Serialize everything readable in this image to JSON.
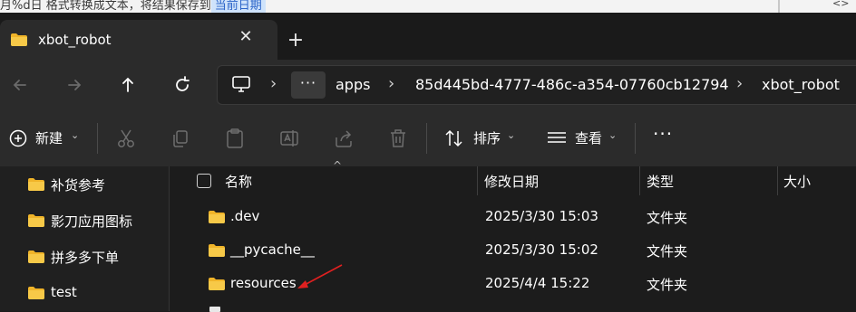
{
  "top_strip": {
    "left_text": "月%d日 格式转换成文本，将结果保存到",
    "highlight_text": "当前日期"
  },
  "tab": {
    "title": "xbot_robot",
    "close_icon": "close-icon",
    "new_tab_icon": "plus-icon"
  },
  "nav": {
    "back_icon": "arrow-left-icon",
    "forward_icon": "arrow-right-icon",
    "up_icon": "arrow-up-icon",
    "refresh_icon": "refresh-icon"
  },
  "address": {
    "more_label": "···",
    "crumbs": [
      "apps",
      "85d445bd-4777-486c-a354-07760cb12794",
      "xbot_robot"
    ]
  },
  "toolbar": {
    "new_label": "新建",
    "sort_label": "排序",
    "view_label": "查看",
    "more_label": "···"
  },
  "sidebar": {
    "items": [
      "补货参考",
      "影刀应用图标",
      "拼多多下单",
      "test"
    ]
  },
  "columns": {
    "name": "名称",
    "modified": "修改日期",
    "type": "类型",
    "size": "大小"
  },
  "files": [
    {
      "name": ".dev",
      "modified": "2025/3/30 15:03",
      "type": "文件夹"
    },
    {
      "name": "__pycache__",
      "modified": "2025/3/30 15:02",
      "type": "文件夹"
    },
    {
      "name": "resources",
      "modified": "2025/4/4 15:22",
      "type": "文件夹"
    }
  ],
  "colors": {
    "folder": "#f0b429",
    "annotation_arrow": "#e02020",
    "background": "#1c1c1c"
  }
}
